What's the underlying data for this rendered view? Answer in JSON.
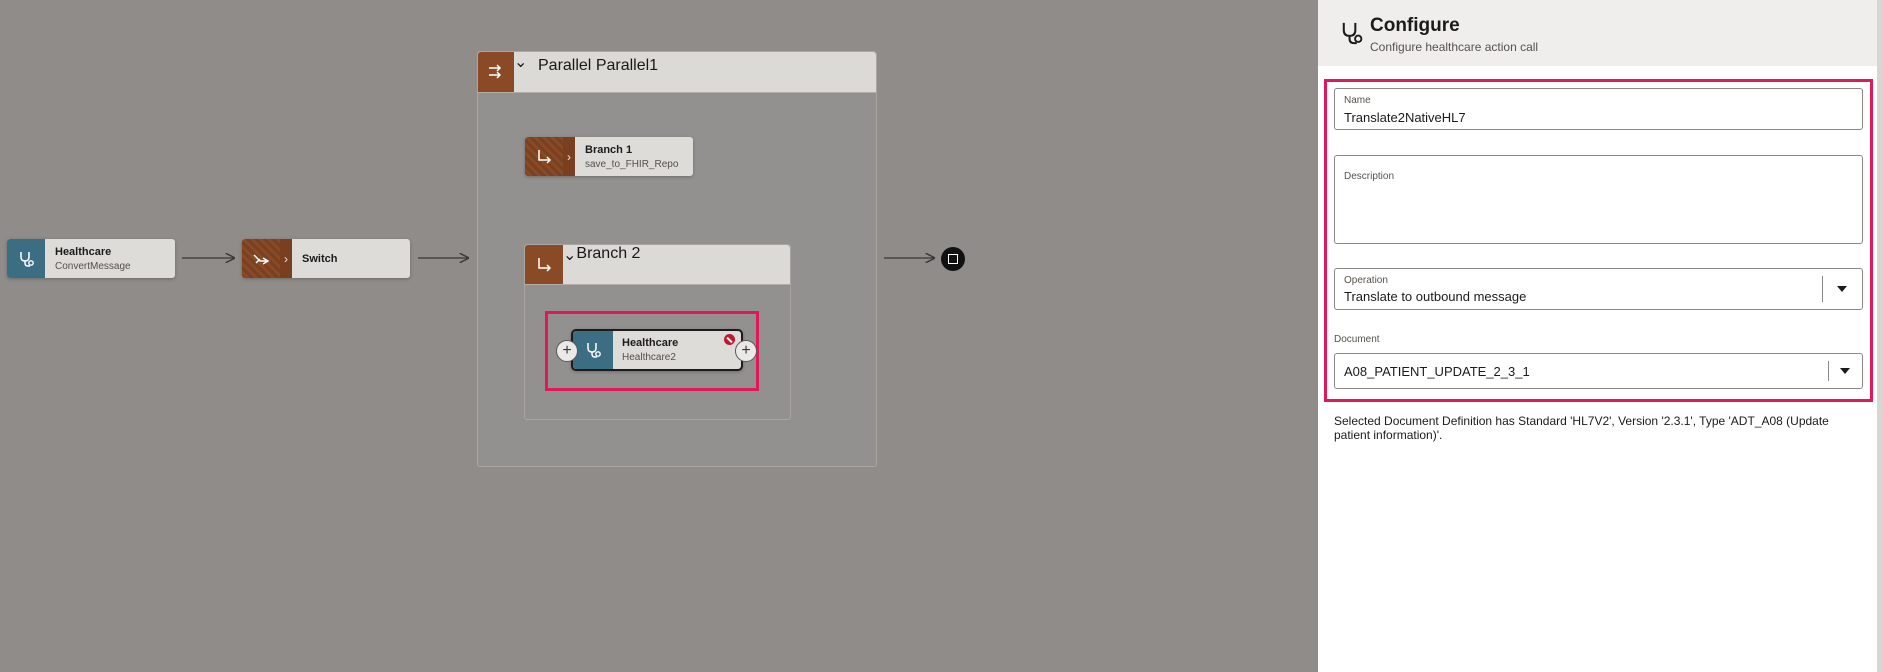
{
  "canvas": {
    "node_healthcare": {
      "title": "Healthcare",
      "subtitle": "ConvertMessage",
      "icon": "stethoscope-icon"
    },
    "node_switch": {
      "title": "Switch",
      "icon": "switch-icon"
    },
    "parallel": {
      "title": "Parallel",
      "subtitle": "Parallel1",
      "icon": "parallel-icon"
    },
    "branch1": {
      "title": "Branch 1",
      "subtitle": "save_to_FHIR_Repo",
      "icon": "branch-icon"
    },
    "branch2": {
      "title": "Branch 2",
      "icon": "branch-icon"
    },
    "selected_node": {
      "title": "Healthcare",
      "subtitle": "Healthcare2",
      "icon": "stethoscope-icon",
      "error_icon": "error-badge-icon"
    },
    "end_icon": "stop-icon",
    "highlight_color": "#e0195a"
  },
  "panel": {
    "icon": "stethoscope-icon",
    "title": "Configure",
    "subtitle": "Configure healthcare action call",
    "name_label": "Name",
    "name_value": "Translate2NativeHL7",
    "description_label": "Description",
    "description_value": "",
    "operation_label": "Operation",
    "operation_value": "Translate to outbound message",
    "document_label": "Document",
    "document_value": "A08_PATIENT_UPDATE_2_3_1",
    "info_text": "Selected Document Definition has Standard 'HL7V2', Version '2.3.1', Type 'ADT_A08 (Update patient information)'."
  }
}
